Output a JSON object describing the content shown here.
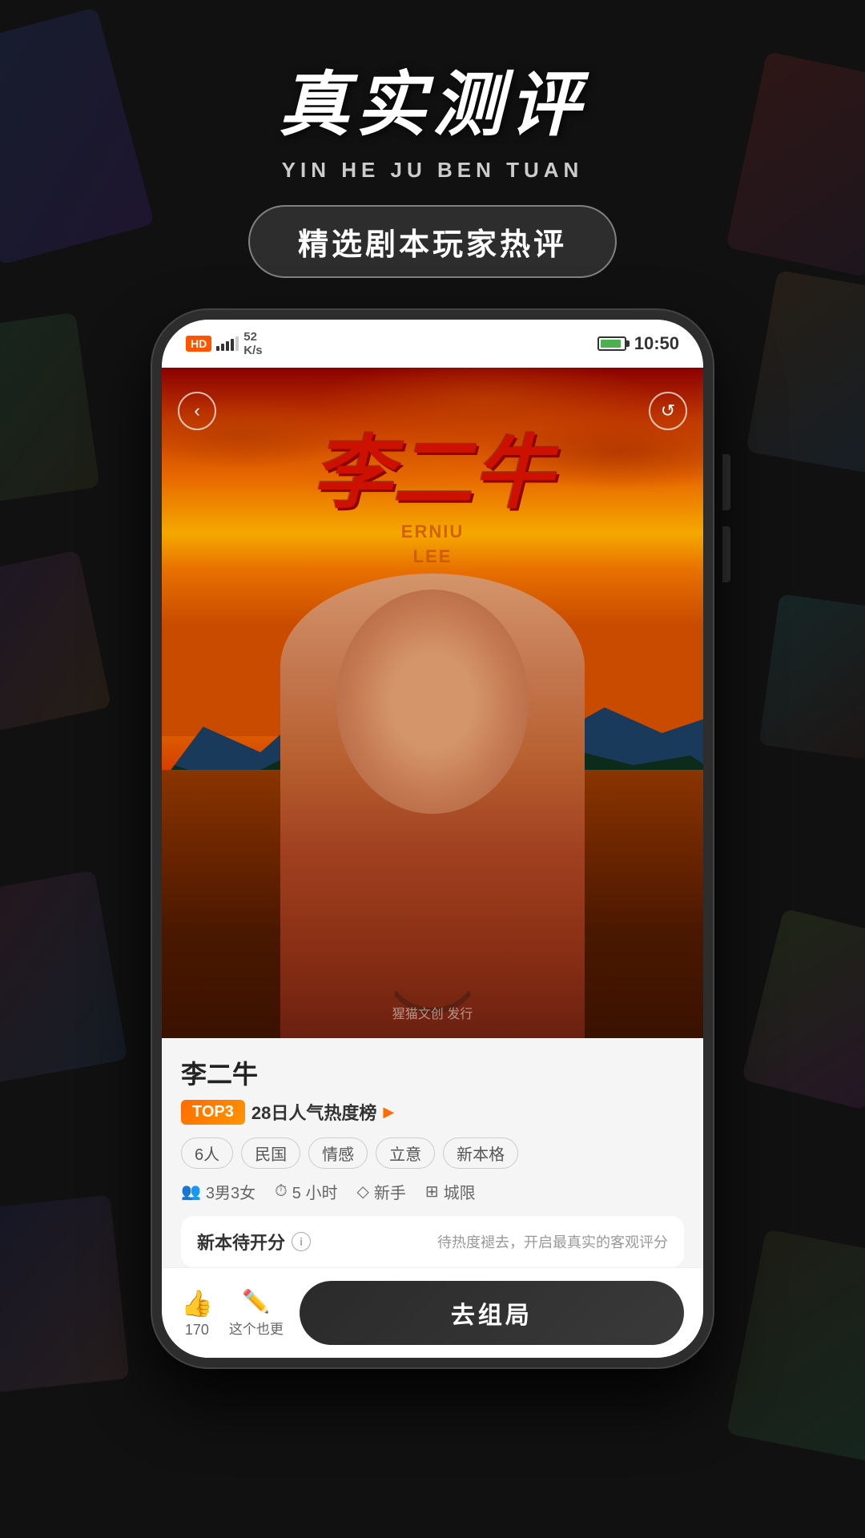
{
  "app": {
    "title": "银河剧本团",
    "subtitle_cn": "真实测评",
    "subtitle_en": "YIN HE JU BEN TUAN",
    "tagline": "精选剧本玩家热评"
  },
  "status_bar": {
    "signal_type": "4G",
    "signal_label": "HD",
    "speed": "52\nK/s",
    "battery_percent": "95",
    "time": "10:50"
  },
  "movie": {
    "name": "李二牛",
    "poster_title_cn": "李二牛",
    "poster_title_en": "ERNIU\nLEE",
    "watermark": "猩猫文创 发行",
    "rank": {
      "badge": "TOP3",
      "text": "28日人气热度榜"
    },
    "tags": [
      "6人",
      "民国",
      "情感",
      "立意",
      "新本格"
    ],
    "meta": {
      "players": "3男3女",
      "duration": "5 小时",
      "difficulty": "新手",
      "scene": "城限"
    },
    "rating": {
      "label": "新本待开分",
      "hint": "待热度褪去，开启最真实的客观评分"
    },
    "actions": {
      "like_count": "170",
      "review_label": "这个也更",
      "play_label": "去组局"
    }
  },
  "nav": {
    "back": "‹",
    "refresh": "↺"
  }
}
